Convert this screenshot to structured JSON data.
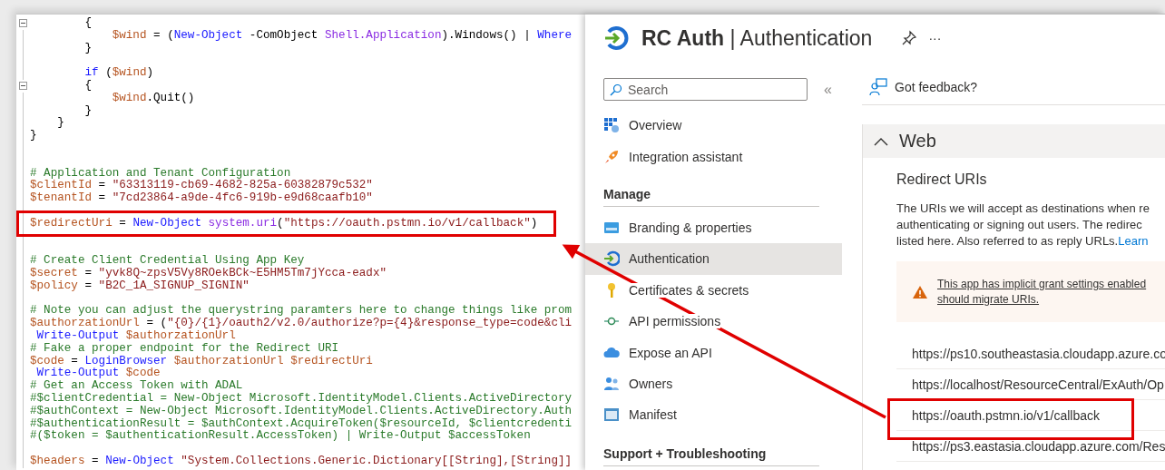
{
  "editor": {
    "lines": [
      {
        "fold": true,
        "segments": [
          {
            "t": "        {",
            "kind": "txt"
          }
        ]
      },
      {
        "fold": false,
        "segments": [
          {
            "t": "            $wind",
            "kind": "var"
          },
          {
            "t": " = (",
            "kind": "txt"
          },
          {
            "t": "New-Object",
            "kind": "kw"
          },
          {
            "t": " -ComObject ",
            "kind": "txt"
          },
          {
            "t": "Shell.Application",
            "kind": "type"
          },
          {
            "t": ").Windows() | ",
            "kind": "txt"
          },
          {
            "t": "Where",
            "kind": "kw"
          }
        ]
      },
      {
        "fold": false,
        "segments": [
          {
            "t": "        }",
            "kind": "txt"
          }
        ]
      },
      {
        "fold": false
      },
      {
        "fold": false,
        "segments": [
          {
            "t": "        if",
            "kind": "kw"
          },
          {
            "t": " (",
            "kind": "txt"
          },
          {
            "t": "$wind",
            "kind": "var"
          },
          {
            "t": ")",
            "kind": "txt"
          }
        ]
      },
      {
        "fold": true,
        "segments": [
          {
            "t": "        {",
            "kind": "txt"
          }
        ]
      },
      {
        "fold": false,
        "segments": [
          {
            "t": "            $wind",
            "kind": "var"
          },
          {
            "t": ".Quit()",
            "kind": "txt"
          }
        ]
      },
      {
        "fold": false,
        "segments": [
          {
            "t": "        }",
            "kind": "txt"
          }
        ]
      },
      {
        "fold": false,
        "segments": [
          {
            "t": "    }",
            "kind": "txt"
          }
        ]
      },
      {
        "fold": false,
        "segments": [
          {
            "t": "}",
            "kind": "txt"
          }
        ]
      },
      {
        "fold": false
      },
      {
        "fold": false
      },
      {
        "fold": false,
        "segments": [
          {
            "t": "# Application and Tenant Configuration",
            "kind": "cmt"
          }
        ]
      },
      {
        "fold": false,
        "segments": [
          {
            "t": "$clientId",
            "kind": "var"
          },
          {
            "t": " = ",
            "kind": "txt"
          },
          {
            "t": "\"63313119-cb69-4682-825a-60382879c532\"",
            "kind": "str"
          }
        ]
      },
      {
        "fold": false,
        "segments": [
          {
            "t": "$tenantId",
            "kind": "var"
          },
          {
            "t": " = ",
            "kind": "txt"
          },
          {
            "t": "\"7cd23864-a9de-4fc6-919b-e9d68caafb10\"",
            "kind": "str"
          }
        ]
      },
      {
        "fold": false
      },
      {
        "fold": false,
        "segments": [
          {
            "t": "$redirectUri",
            "kind": "var"
          },
          {
            "t": " = ",
            "kind": "txt"
          },
          {
            "t": "New-Object",
            "kind": "kw"
          },
          {
            "t": " system.uri",
            "kind": "type"
          },
          {
            "t": "(",
            "kind": "txt"
          },
          {
            "t": "\"https://oauth.pstmn.io/v1/callback\"",
            "kind": "str"
          },
          {
            "t": ")",
            "kind": "txt"
          }
        ]
      },
      {
        "fold": false
      },
      {
        "fold": false
      },
      {
        "fold": false,
        "segments": [
          {
            "t": "# Create Client Credential Using App Key",
            "kind": "cmt"
          }
        ]
      },
      {
        "fold": false,
        "segments": [
          {
            "t": "$secret",
            "kind": "var"
          },
          {
            "t": " = ",
            "kind": "txt"
          },
          {
            "t": "\"yvk8Q~zpsV5Vy8ROekBCk~E5HM5Tm7jYcca-eadx\"",
            "kind": "str"
          }
        ]
      },
      {
        "fold": false,
        "segments": [
          {
            "t": "$policy",
            "kind": "var"
          },
          {
            "t": " = ",
            "kind": "txt"
          },
          {
            "t": "\"B2C_1A_SIGNUP_SIGNIN\"",
            "kind": "str"
          }
        ]
      },
      {
        "fold": false
      },
      {
        "fold": false,
        "segments": [
          {
            "t": "# Note you can adjust the querystring paramters here to change things like prom",
            "kind": "cmt"
          }
        ]
      },
      {
        "fold": false,
        "segments": [
          {
            "t": "$authorzationUrl",
            "kind": "var"
          },
          {
            "t": " = (",
            "kind": "txt"
          },
          {
            "t": "\"{0}/{1}/oauth2/v2.0/authorize?p={4}&response_type=code&cli",
            "kind": "str"
          }
        ]
      },
      {
        "fold": false,
        "segments": [
          {
            "t": " Write-Output",
            "kind": "kw"
          },
          {
            "t": " $authorzationUrl",
            "kind": "var"
          }
        ]
      },
      {
        "fold": false,
        "segments": [
          {
            "t": "# Fake a proper endpoint for the Redirect URI",
            "kind": "cmt"
          }
        ]
      },
      {
        "fold": false,
        "segments": [
          {
            "t": "$code",
            "kind": "var"
          },
          {
            "t": " = ",
            "kind": "txt"
          },
          {
            "t": "LoginBrowser",
            "kind": "kw"
          },
          {
            "t": " $authorzationUrl $redirectUri",
            "kind": "var"
          }
        ]
      },
      {
        "fold": false,
        "segments": [
          {
            "t": " Write-Output",
            "kind": "kw"
          },
          {
            "t": " $code",
            "kind": "var"
          }
        ]
      },
      {
        "fold": false,
        "segments": [
          {
            "t": "# Get an Access Token with ADAL",
            "kind": "cmt"
          }
        ]
      },
      {
        "fold": false,
        "segments": [
          {
            "t": "#$clientCredential = New-Object Microsoft.IdentityModel.Clients.ActiveDirectory",
            "kind": "cmt"
          }
        ]
      },
      {
        "fold": false,
        "segments": [
          {
            "t": "#$authContext = New-Object Microsoft.IdentityModel.Clients.ActiveDirectory.Auth",
            "kind": "cmt"
          }
        ]
      },
      {
        "fold": false,
        "segments": [
          {
            "t": "#$authenticationResult = $authContext.AcquireToken($resourceId, $clientcredenti",
            "kind": "cmt"
          }
        ]
      },
      {
        "fold": false,
        "segments": [
          {
            "t": "#($token = $authenticationResult.AccessToken) | Write-Output $accessToken",
            "kind": "cmt"
          }
        ]
      },
      {
        "fold": false
      },
      {
        "fold": false,
        "segments": [
          {
            "t": "$headers",
            "kind": "var"
          },
          {
            "t": " = ",
            "kind": "txt"
          },
          {
            "t": "New-Object",
            "kind": "kw"
          },
          {
            "t": " \"System.Collections.Generic.Dictionary[[String],[String]]",
            "kind": "str"
          }
        ]
      }
    ]
  },
  "portal": {
    "title": "**RC Auth** | Authentication",
    "more": "···",
    "search": {
      "placeholder": "Search"
    },
    "collapse": "«",
    "nav": [
      {
        "kind": "grid",
        "label": "Overview",
        "selected": false
      },
      {
        "kind": "rocket",
        "label": "Integration assistant",
        "selected": false
      },
      {
        "kind": "heading",
        "label": "Manage"
      },
      {
        "kind": "card",
        "label": "Branding & properties",
        "selected": false
      },
      {
        "kind": "signin",
        "label": "Authentication",
        "selected": true
      },
      {
        "kind": "key",
        "label": "Certificates & secrets",
        "selected": false
      },
      {
        "kind": "plug",
        "label": "API permissions",
        "selected": false
      },
      {
        "kind": "cloud",
        "label": "Expose an API",
        "selected": false
      },
      {
        "kind": "people",
        "label": "Owners",
        "selected": false
      },
      {
        "kind": "manifest",
        "label": "Manifest",
        "selected": false
      },
      {
        "kind": "heading",
        "label": "Support + Troubleshooting"
      }
    ],
    "feedback": "Got feedback?",
    "section": {
      "title": "Web",
      "expanded": true,
      "subtitle": "Redirect URIs",
      "description": [
        "The URIs we will accept as destinations when re",
        "authenticating or signing out users. The redirec",
        "listed here. Also referred to as reply URLs."
      ],
      "learn_link": "Learn",
      "warning": [
        "This app has implicit grant settings enabled",
        "should migrate URIs."
      ],
      "uris": [
        "https://ps10.southeastasia.cloudapp.azure.co",
        "https://localhost/ResourceCentral/ExAuth/Op",
        "https://oauth.pstmn.io/v1/callback",
        "https://ps3.eastasia.cloudapp.azure.com/Res"
      ]
    }
  }
}
